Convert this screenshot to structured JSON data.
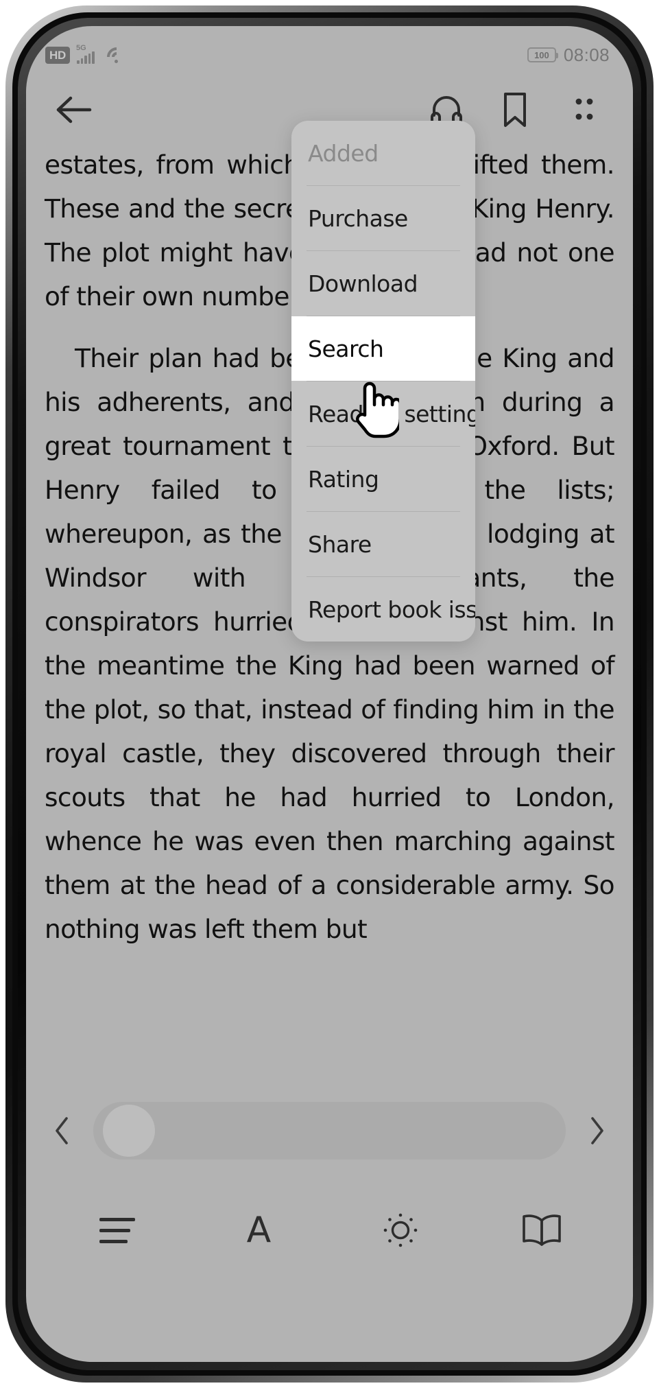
{
  "status_bar": {
    "hd_label": "HD",
    "network_label": "5G",
    "signal_icon": "signal-bars-icon",
    "wifi_icon": "wifi-icon",
    "battery_level": "100",
    "time": "08:08"
  },
  "toolbar": {
    "back_icon": "back-arrow-icon",
    "headphones_icon": "headphones-icon",
    "bookmark_icon": "bookmark-icon",
    "more_icon": "more-options-icon"
  },
  "reader": {
    "paragraphs": [
      "estates, from which King Henry lifted them. These and the secret plot to take King Henry. The plot might have succeeded had not one of their own number betrayed it.",
      "Their plan had been to seize the King and his adherents, and murder them during a great tournament to be held at Oxford. But Henry failed to appear at the lists; whereupon, as the King had been lodging at Windsor with few attendants, the conspirators hurried thither against him. In the meantime the King had been warned of the plot, so that, instead of finding him in the royal castle, they discovered through their scouts that he had hurried to London, whence he was even then marching against them at the head of a considerable army. So nothing was left them but"
    ]
  },
  "menu": {
    "items": [
      {
        "label": "Added",
        "state": "disabled"
      },
      {
        "label": "Purchase",
        "state": "normal"
      },
      {
        "label": "Download",
        "state": "normal"
      },
      {
        "label": "Search",
        "state": "highlighted"
      },
      {
        "label": "Reading settings",
        "state": "normal"
      },
      {
        "label": "Rating",
        "state": "normal"
      },
      {
        "label": "Share",
        "state": "normal"
      },
      {
        "label": "Report book issue",
        "state": "normal"
      }
    ],
    "highlight_color": "#ffffff",
    "background_color": "#c4c4c4"
  },
  "cursor": {
    "icon": "pointing-hand-cursor"
  },
  "progress": {
    "prev_icon": "chevron-left-icon",
    "next_icon": "chevron-right-icon",
    "thumb_icon": "slider-thumb"
  },
  "bottom_bar": {
    "items": [
      {
        "icon": "table-of-contents-icon"
      },
      {
        "icon": "font-size-icon",
        "glyph": "A"
      },
      {
        "icon": "brightness-icon"
      },
      {
        "icon": "reading-mode-book-icon"
      }
    ]
  }
}
